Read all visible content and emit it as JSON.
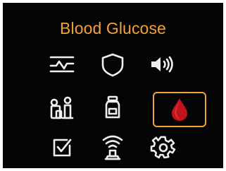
{
  "menu": {
    "title": "Blood Glucose",
    "selected_index": 5,
    "items": [
      {
        "icon": "trend-graph-icon"
      },
      {
        "icon": "shield-icon"
      },
      {
        "icon": "speaker-volume-icon"
      },
      {
        "icon": "user-group-icon"
      },
      {
        "icon": "insulin-vial-icon"
      },
      {
        "icon": "blood-drop-icon"
      },
      {
        "icon": "checkbox-icon"
      },
      {
        "icon": "wireless-transmitter-icon"
      },
      {
        "icon": "gear-icon"
      }
    ]
  },
  "colors": {
    "background": "#050505",
    "accent": "#f0a23c",
    "icon": "#efefef",
    "blood": "#c4121c"
  }
}
